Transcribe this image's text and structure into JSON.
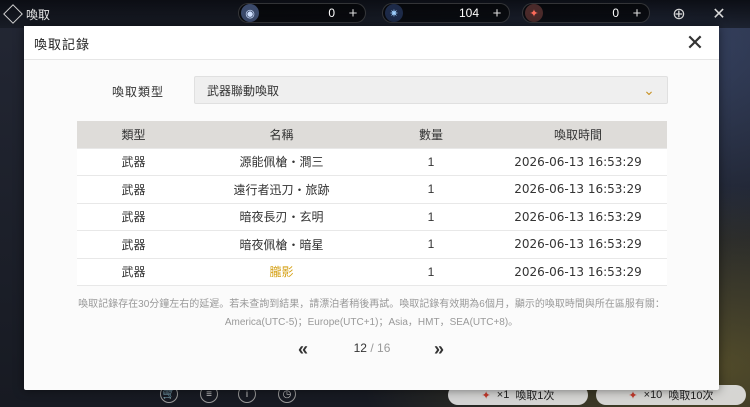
{
  "topbar": {
    "back_label": "喚取",
    "currencies": [
      {
        "icon": "coin-icon",
        "value": "0"
      },
      {
        "icon": "star-crystal-icon",
        "value": "104"
      },
      {
        "icon": "ticket-icon",
        "value": "0"
      }
    ]
  },
  "modal": {
    "title": "喚取記錄",
    "filter_label": "喚取類型",
    "filter_value": "武器聯動喚取",
    "columns": [
      "類型",
      "名稱",
      "數量",
      "喚取時間"
    ],
    "rows": [
      {
        "type": "武器",
        "name": "源能佩槍・澗三",
        "qty": "1",
        "time": "2026-06-13 16:53:29",
        "highlight": false
      },
      {
        "type": "武器",
        "name": "遠行者迅刀・旅跡",
        "qty": "1",
        "time": "2026-06-13 16:53:29",
        "highlight": false
      },
      {
        "type": "武器",
        "name": "暗夜長刃・玄明",
        "qty": "1",
        "time": "2026-06-13 16:53:29",
        "highlight": false
      },
      {
        "type": "武器",
        "name": "暗夜佩槍・暗星",
        "qty": "1",
        "time": "2026-06-13 16:53:29",
        "highlight": false
      },
      {
        "type": "武器",
        "name": "朧影",
        "qty": "1",
        "time": "2026-06-13 16:53:29",
        "highlight": true
      }
    ],
    "note_line1": "喚取記錄存在30分鐘左右的延遲。若未查詢到結果，請漂泊者稍後再試。喚取記錄有效期為6個月，顯示的喚取時間與所在區服有關：",
    "note_line2": "America(UTC-5)；Europe(UTC+1)；Asia，HMT，SEA(UTC+8)。",
    "pager": {
      "current": "12",
      "separator": "/",
      "total": "16"
    }
  },
  "bottom": {
    "pull1_count": "×1",
    "pull1_label": "喚取1次",
    "pull10_count": "×10",
    "pull10_label": "喚取10次"
  },
  "colors": {
    "accent_gold": "#d6a31c",
    "chevron": "#c9952b"
  }
}
